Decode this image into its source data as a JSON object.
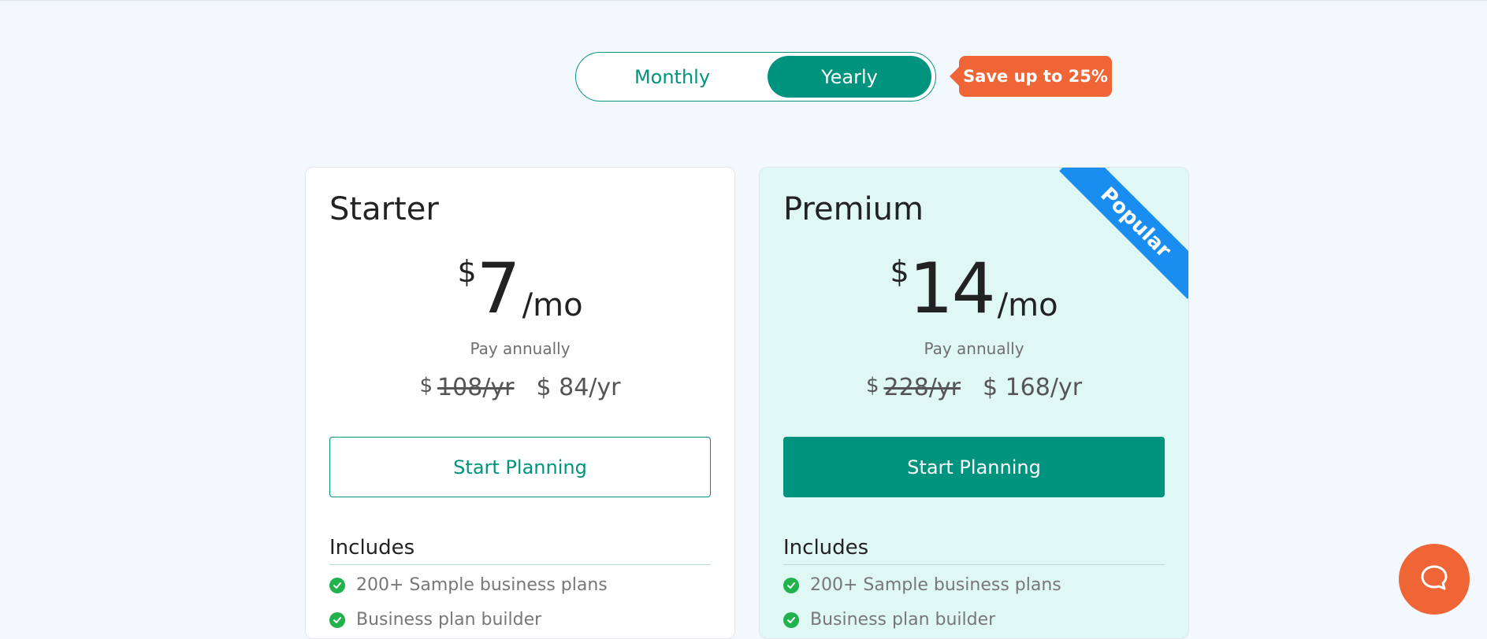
{
  "billing_toggle": {
    "monthly_label": "Monthly",
    "yearly_label": "Yearly",
    "selected": "Yearly"
  },
  "save_badge": "Save up to 25%",
  "plans": [
    {
      "name": "Starter",
      "currency": "$",
      "price": "7",
      "period": "/mo",
      "pay_note": "Pay annually",
      "yearly_currency": "$",
      "old_yearly": "108/yr",
      "new_yearly": "$ 84/yr",
      "cta": "Start Planning",
      "includes_heading": "Includes",
      "features": [
        "200+ Sample business plans",
        "Business plan builder"
      ]
    },
    {
      "name": "Premium",
      "ribbon": "Popular",
      "currency": "$",
      "price": "14",
      "period": "/mo",
      "pay_note": "Pay annually",
      "yearly_currency": "$",
      "old_yearly": "228/yr",
      "new_yearly": "$ 168/yr",
      "cta": "Start Planning",
      "includes_heading": "Includes",
      "features": [
        "200+ Sample business plans",
        "Business plan builder"
      ]
    }
  ],
  "chat": {
    "icon": "chat-bubble-icon"
  },
  "colors": {
    "accent": "#00947f",
    "badge": "#ef6536",
    "ribbon": "#1a8ef0",
    "check": "#22b24c",
    "premium_bg": "#e0f8f4"
  }
}
